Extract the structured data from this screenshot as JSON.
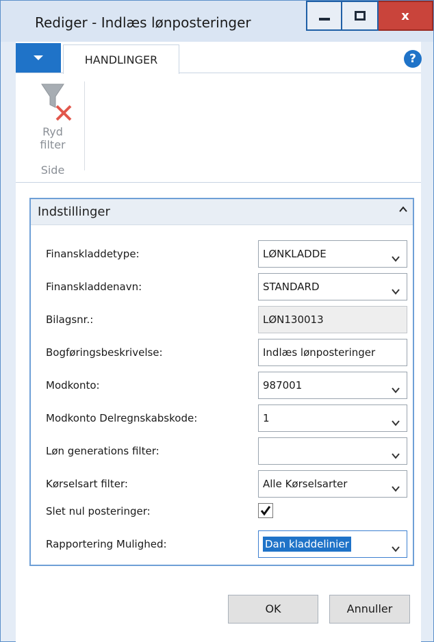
{
  "window": {
    "title": "Rediger - Indlæs lønposteringer",
    "controls": {
      "minimize": "minimize-icon",
      "maximize": "maximize-icon",
      "close_glyph": "x"
    }
  },
  "ribbon": {
    "tab_label": "HANDLINGER",
    "help_glyph": "?",
    "action_label_line1": "Ryd",
    "action_label_line2": "filter",
    "group_label": "Side"
  },
  "panel": {
    "title": "Indstillinger",
    "fields": [
      {
        "label": "Finanskladdetype:",
        "value": "LØNKLADDE",
        "kind": "dropdown"
      },
      {
        "label": "Finanskladdenavn:",
        "value": "STANDARD",
        "kind": "dropdown"
      },
      {
        "label": "Bilagsnr.:",
        "value": "LØN130013",
        "kind": "readonly"
      },
      {
        "label": "Bogføringsbeskrivelse:",
        "value": "Indlæs lønposteringer",
        "kind": "text"
      },
      {
        "label": "Modkonto:",
        "value": "987001",
        "kind": "dropdown"
      },
      {
        "label": "Modkonto Delregnskabskode:",
        "value": "1",
        "kind": "dropdown"
      },
      {
        "label": "Løn generations filter:",
        "value": "",
        "kind": "dropdown"
      },
      {
        "label": "Kørselsart filter:",
        "value": "Alle Kørselsarter",
        "kind": "dropdown"
      },
      {
        "label": "Slet nul posteringer:",
        "checked": true,
        "kind": "checkbox"
      },
      {
        "label": "Rapportering Mulighed:",
        "value": "Dan kladdelinier",
        "kind": "dropdown-focused"
      }
    ]
  },
  "buttons": {
    "ok": "OK",
    "cancel": "Annuller"
  },
  "colors": {
    "accent": "#1f73c8",
    "close": "#c9443b",
    "panel_border": "#6e9fd6"
  }
}
